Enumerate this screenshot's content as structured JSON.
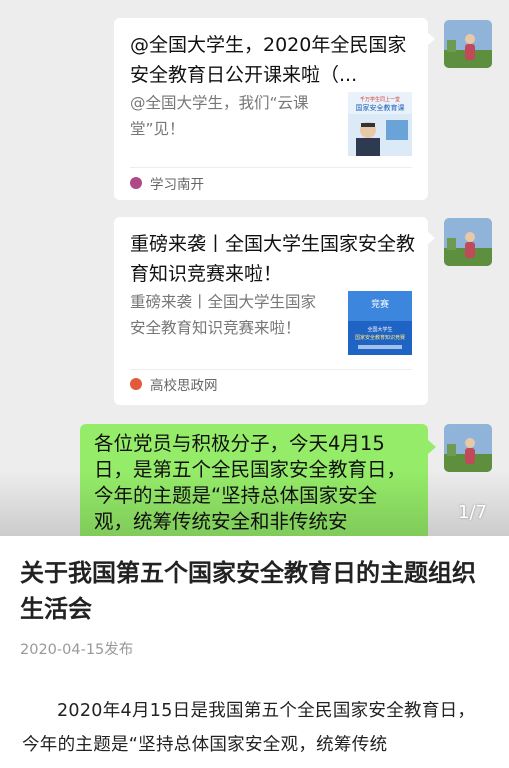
{
  "chat": {
    "cards": [
      {
        "title": "@全国大学生，2020年全民国家安全教育日公开课来啦（...",
        "description": "@全国大学生，我们“云课堂”见！",
        "source": "学习南开",
        "source_color": "#b04a86",
        "thumb_text": "千万学生同上一堂国家安全教育课"
      },
      {
        "title": "重磅来袭丨全国大学生国家安全教育知识竞赛来啦！",
        "description": "重磅来袭丨全国大学生国家安全教育知识竞赛来啦！",
        "source": "高校思政网",
        "source_color": "#e25a3a",
        "thumb_text": "全国大学生国家安全教育知识竞赛"
      }
    ],
    "message": {
      "text": "各位党员与积极分子，今天4月15日，是第五个全民国家安全教育日，今年的主题是“坚持总体国家安全观，统筹传统安全和非传统安"
    },
    "bubble_color": "#95ec69",
    "page_counter": "1/7"
  },
  "article": {
    "title": "关于我国第五个国家安全教育日的主题组织生活会",
    "date": "2020-04-15发布",
    "body": "2020年4月15日是我国第五个全民国家安全教育日，今年的主题是“坚持总体国家安全观，统筹传统"
  }
}
